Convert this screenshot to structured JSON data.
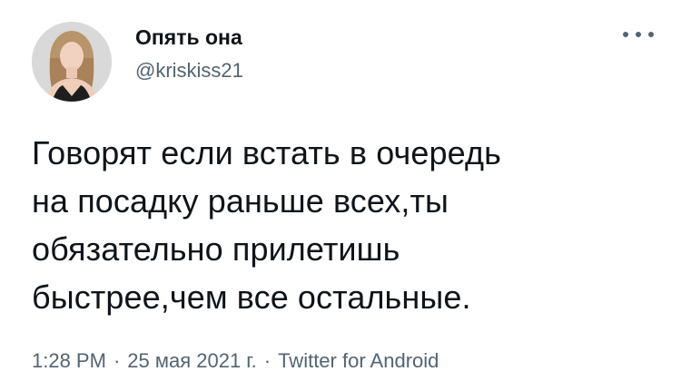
{
  "author": {
    "display_name": "Опять она",
    "handle": "@kriskiss21"
  },
  "tweet": {
    "text": "Говорят если встать в очередь\nна посадку раньше всех,ты\nобязательно прилетишь\nбыстрее,чем все остальные."
  },
  "meta": {
    "time": "1:28 PM",
    "separator": "·",
    "date": "25 мая 2021 г.",
    "source": "Twitter for Android"
  },
  "icons": {
    "more": "more-horizontal-icon",
    "avatar": "profile-photo"
  },
  "colors": {
    "text": "#0f1419",
    "secondary": "#536471",
    "background": "#ffffff"
  }
}
